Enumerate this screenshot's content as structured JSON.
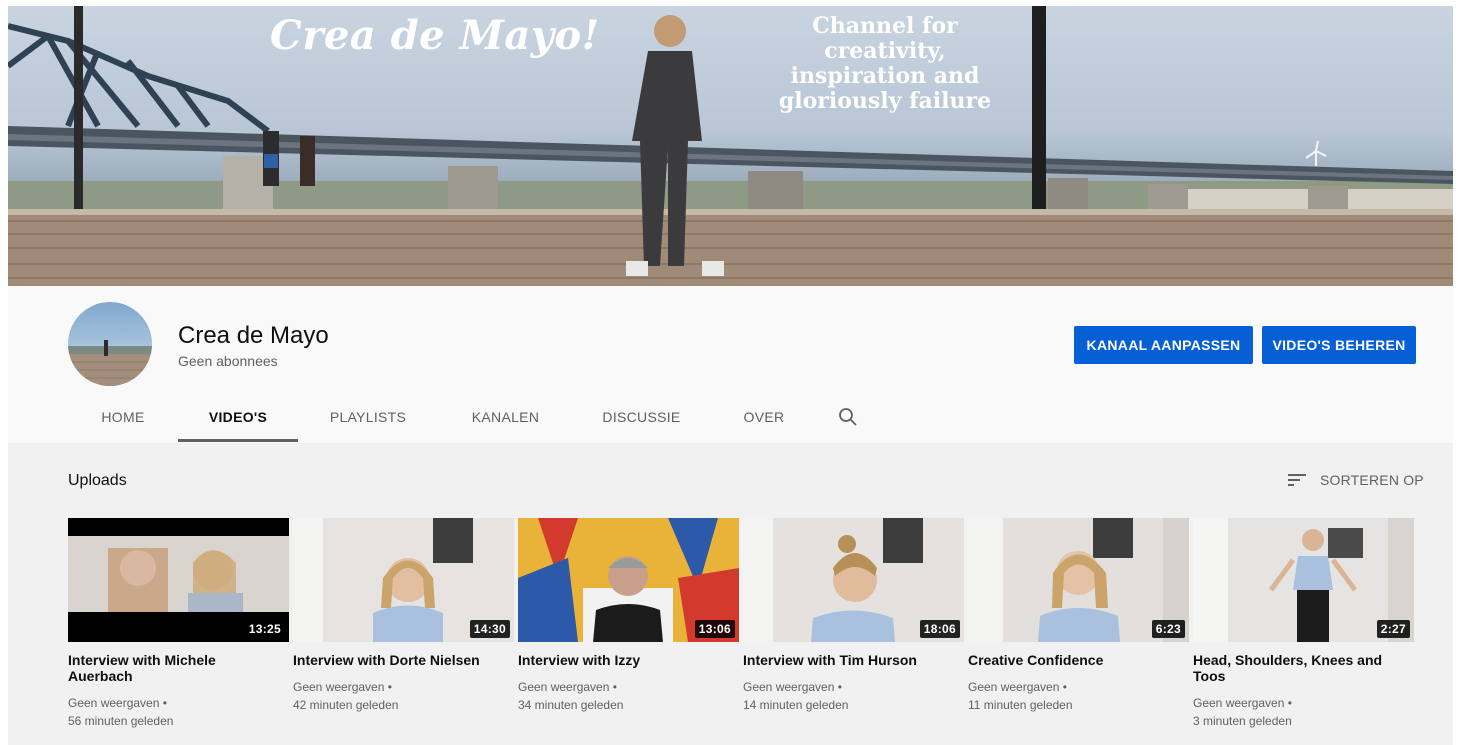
{
  "banner": {
    "title": "Crea de Mayo!",
    "tagline_lines": [
      "Channel for",
      "creativity,",
      "inspiration and",
      "gloriously failure"
    ]
  },
  "channel": {
    "name": "Crea de Mayo",
    "subscribers": "Geen abonnees"
  },
  "buttons": {
    "customize": "KANAAL AANPASSEN",
    "manage": "VIDEO'S BEHEREN"
  },
  "tabs": [
    {
      "label": "HOME"
    },
    {
      "label": "VIDEO'S",
      "active": true
    },
    {
      "label": "PLAYLISTS"
    },
    {
      "label": "KANALEN"
    },
    {
      "label": "DISCUSSIE"
    },
    {
      "label": "OVER"
    }
  ],
  "icons": {
    "tab_search": "search-icon",
    "sort": "sort-icon"
  },
  "uploads": {
    "title": "Uploads",
    "sort_label": "SORTEREN OP"
  },
  "videos": [
    {
      "title": "Interview with Michele Auerbach",
      "duration": "13:25",
      "views": "Geen weergaven •",
      "age": "56 minuten geleden"
    },
    {
      "title": "Interview with Dorte Nielsen",
      "duration": "14:30",
      "views": "Geen weergaven •",
      "age": "42 minuten geleden"
    },
    {
      "title": "Interview with Izzy",
      "duration": "13:06",
      "views": "Geen weergaven •",
      "age": "34 minuten geleden"
    },
    {
      "title": "Interview with Tim Hurson",
      "duration": "18:06",
      "views": "Geen weergaven •",
      "age": "14 minuten geleden"
    },
    {
      "title": "Creative Confidence",
      "duration": "6:23",
      "views": "Geen weergaven •",
      "age": "11 minuten geleden"
    },
    {
      "title": "Head, Shoulders, Knees and Toos",
      "duration": "2:27",
      "views": "Geen weergaven •",
      "age": "3 minuten geleden"
    }
  ],
  "colors": {
    "primary_button": "#065fd4",
    "header_bg": "#f9f9f9",
    "content_bg": "#f1f1f1"
  }
}
